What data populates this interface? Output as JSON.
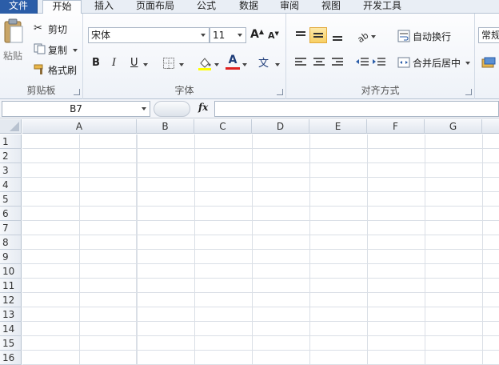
{
  "tabs": [
    {
      "label": "文件"
    },
    {
      "label": "开始"
    },
    {
      "label": "插入"
    },
    {
      "label": "页面布局"
    },
    {
      "label": "公式"
    },
    {
      "label": "数据"
    },
    {
      "label": "审阅"
    },
    {
      "label": "视图"
    },
    {
      "label": "开发工具"
    }
  ],
  "clipboard": {
    "paste_label": "粘贴",
    "cut_label": "剪切",
    "copy_label": "复制",
    "format_painter_label": "格式刷",
    "group_label": "剪贴板"
  },
  "font": {
    "font_name": "宋体",
    "font_size": "11",
    "group_label": "字体",
    "bold": "B",
    "italic": "I",
    "underline": "U"
  },
  "alignment": {
    "wrap_text_label": "自动换行",
    "merge_center_label": "合并后居中",
    "group_label": "对齐方式"
  },
  "number": {
    "format_label": "常规"
  },
  "formula_bar": {
    "name_box": "B7",
    "fx": "fx",
    "formula": ""
  },
  "columns": [
    "A",
    "B",
    "C",
    "D",
    "E",
    "F",
    "G"
  ],
  "rows": [
    "1",
    "2",
    "3",
    "4",
    "5",
    "6",
    "7",
    "8",
    "9",
    "10",
    "11",
    "12",
    "13",
    "14",
    "15",
    "16"
  ],
  "colors": {
    "file_tab": "#2b5da8",
    "font_color_bar": "#e02020",
    "highlight_bar": "#ffff00"
  }
}
